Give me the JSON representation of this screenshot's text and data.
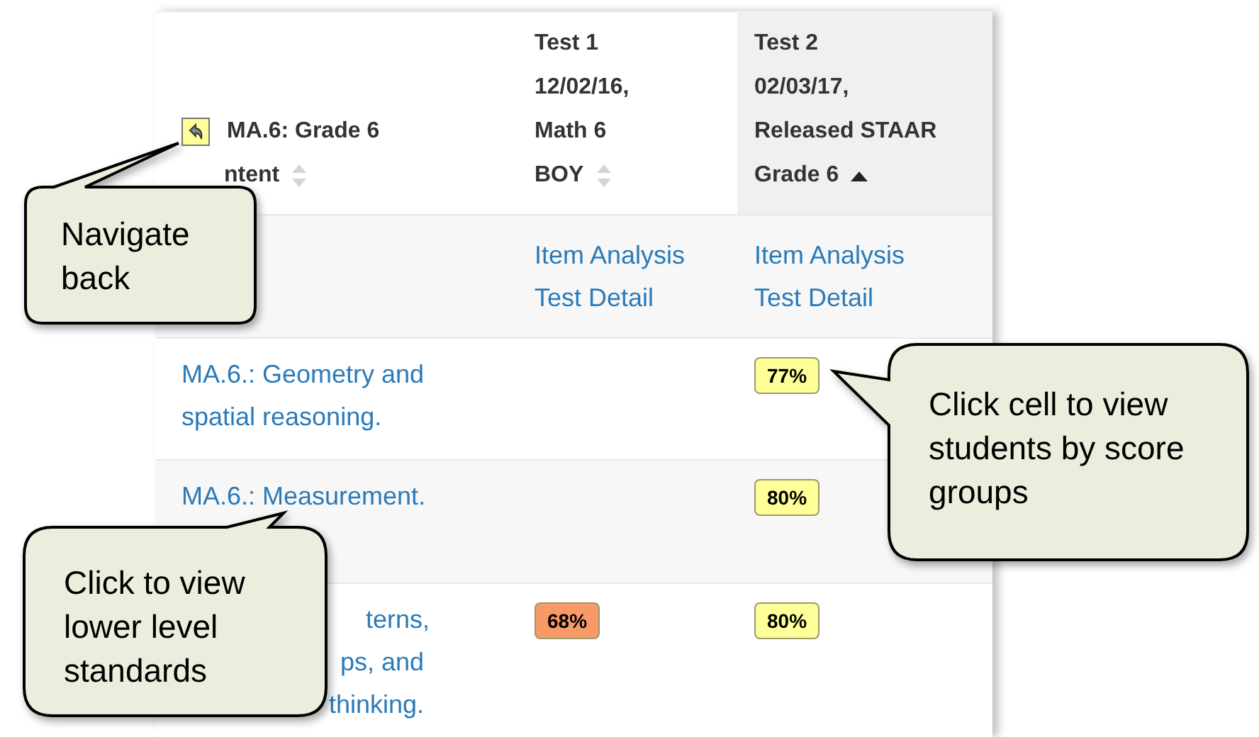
{
  "table": {
    "columns": [
      {
        "kind": "standard",
        "lines": [
          "MA.6: Grade 6",
          "ntent"
        ],
        "sorted": false,
        "selected": false
      },
      {
        "kind": "test",
        "lines": [
          "Test 1",
          "12/02/16,",
          "Math 6",
          "BOY"
        ],
        "sorted": false,
        "selected": false
      },
      {
        "kind": "test",
        "lines": [
          "Test 2",
          "02/03/17,",
          "Released STAAR",
          "Grade 6"
        ],
        "sorted": true,
        "selected": true
      }
    ],
    "links": [
      [
        "Item Analysis",
        "Test Detail"
      ],
      [
        "Item Analysis",
        "Test Detail"
      ]
    ],
    "rows": [
      {
        "kind": "whole",
        "standard": "MA.6.: Geometry and spatial reasoning.",
        "test_2": {
          "value": "77%",
          "color": "#ffff99"
        }
      },
      {
        "kind": "whole",
        "standard": "MA.6.: Measurement.",
        "test_2": {
          "value": "80%",
          "color": "#ffff99"
        }
      },
      {
        "kind": "partial",
        "standard_lines": [
          "terns,",
          "ps, and",
          "thinking."
        ],
        "test_1": {
          "value": "68%",
          "color": "#f79a68"
        },
        "test_2": {
          "value": "80%",
          "color": "#ffff99"
        }
      }
    ]
  },
  "callouts": [
    "Navigate back",
    "Click cell to view students by score groups",
    "Click to view lower level standards"
  ]
}
